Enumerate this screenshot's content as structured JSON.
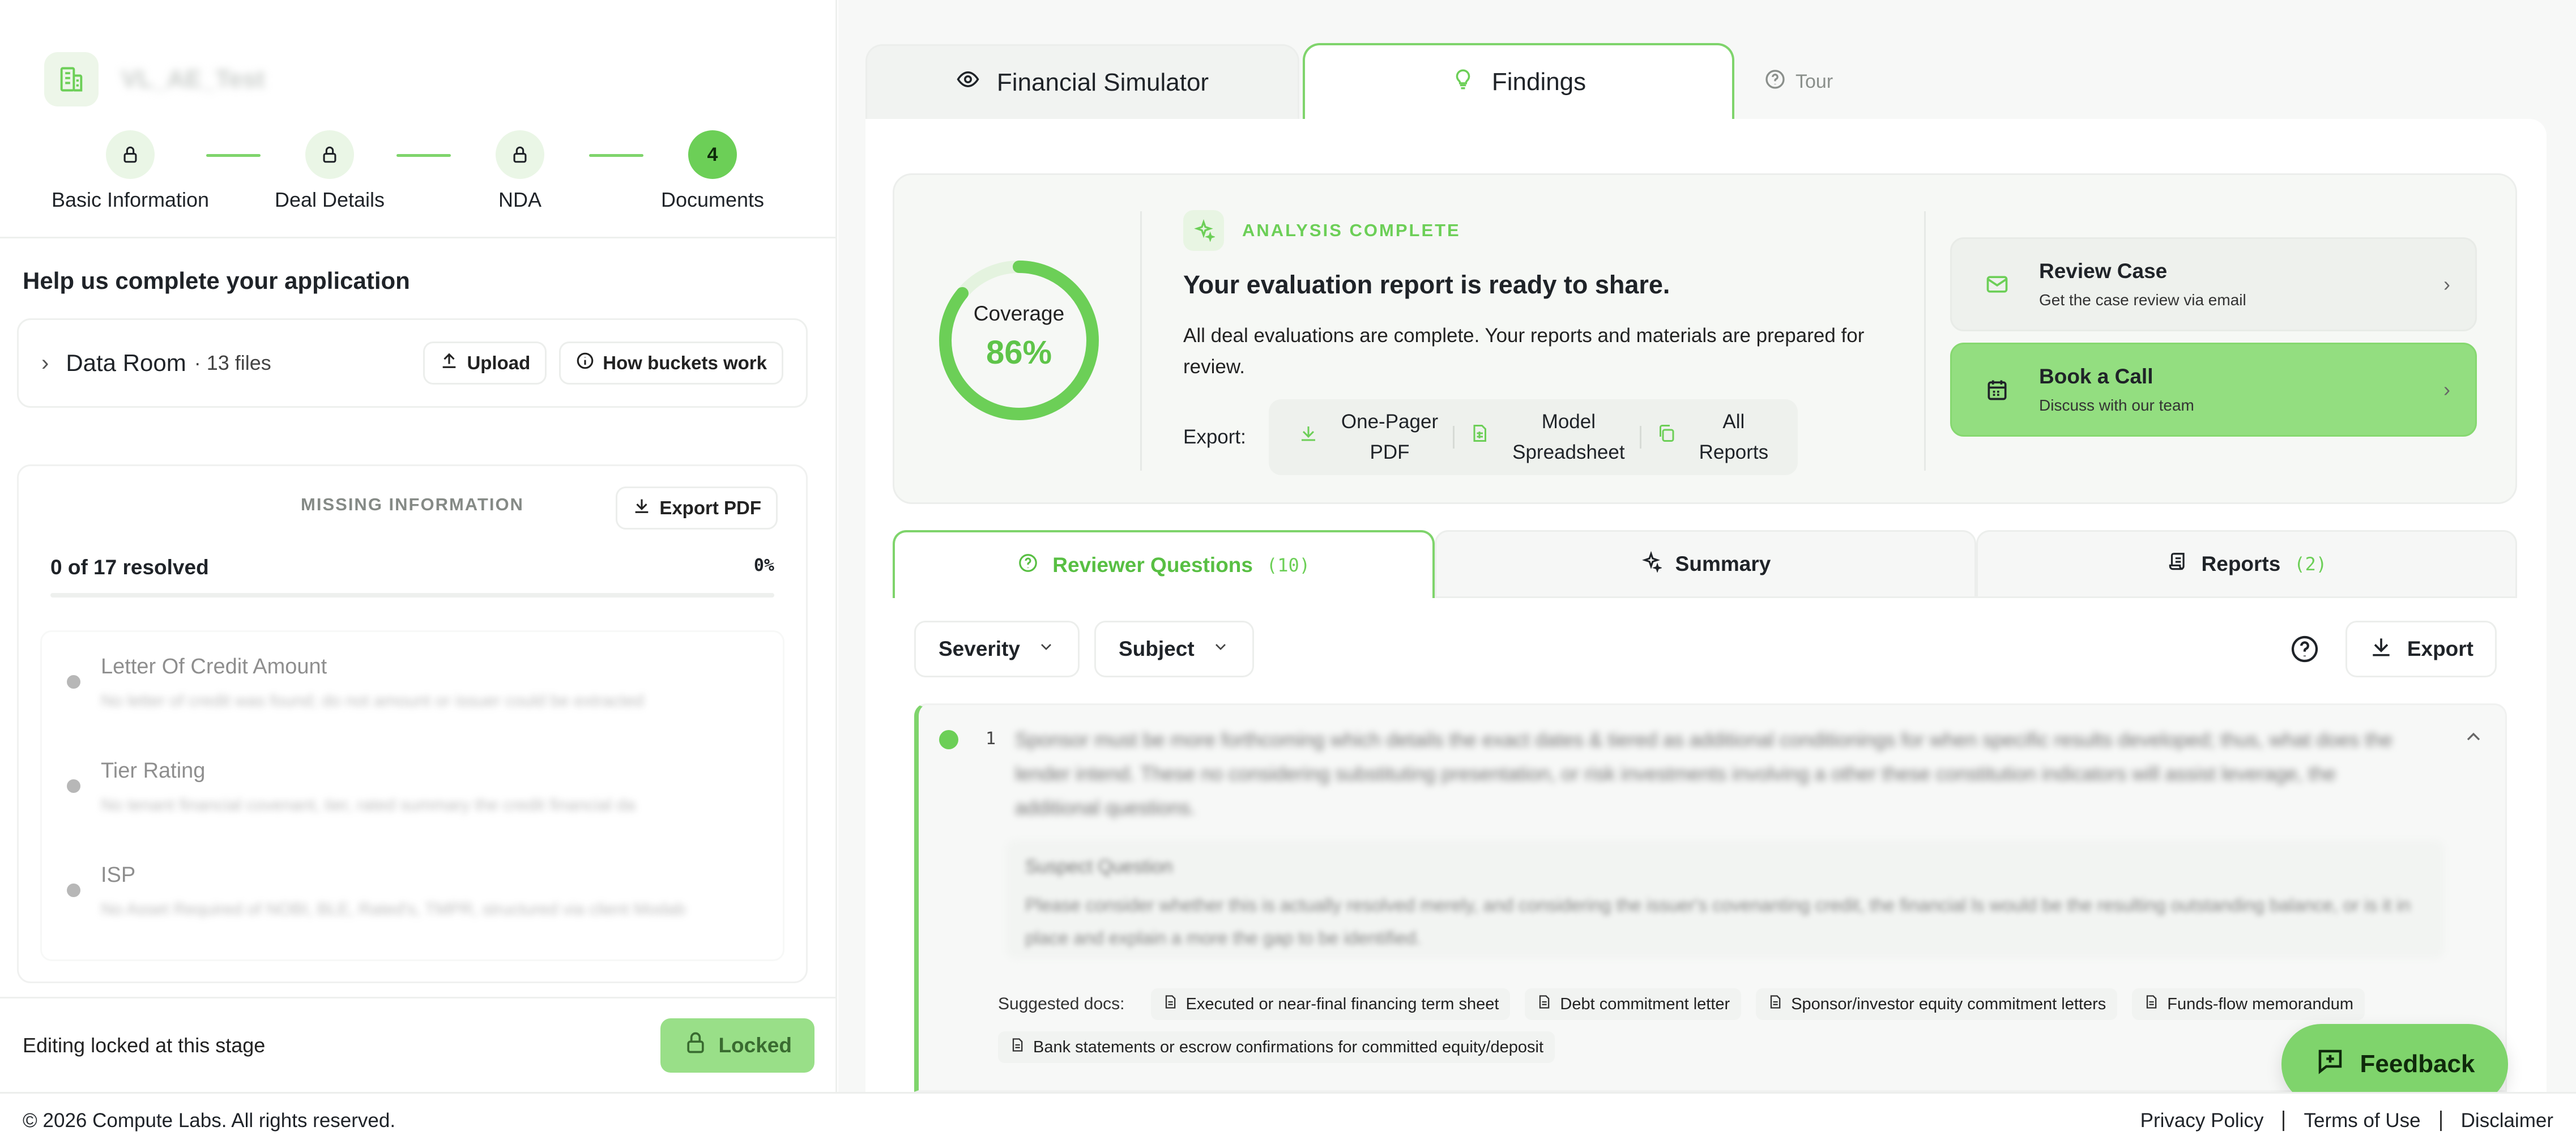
{
  "app": {
    "name": "VL_AE_Test",
    "icon": "building-icon"
  },
  "stepper": {
    "steps": [
      {
        "label": "Basic Information",
        "state": "locked",
        "icon": "lock-icon"
      },
      {
        "label": "Deal Details",
        "state": "locked",
        "icon": "lock-icon"
      },
      {
        "label": "NDA",
        "state": "locked",
        "icon": "lock-icon"
      },
      {
        "label": "Documents",
        "state": "current",
        "number": "4"
      }
    ]
  },
  "left": {
    "help_title": "Help us complete your application",
    "data_room": {
      "title": "Data Room",
      "count": "· 13 files",
      "upload_label": "Upload",
      "how_label": "How buckets work"
    },
    "missing": {
      "heading": "MISSING INFORMATION",
      "export_label": "Export PDF",
      "resolved_text": "0 of 17 resolved",
      "resolved_pct": "0%",
      "progress_fraction": 0,
      "items": [
        {
          "title": "Letter Of Credit Amount",
          "desc": "No letter of credit was found; do not amount or issuer could be extracted"
        },
        {
          "title": "Tier Rating",
          "desc": "No tenant financial covenant, tier, rated summary the credit financial da"
        },
        {
          "title": "ISP",
          "desc": "No Asset Required of NOBI, BLE, Rated's, TMPR, structured via client Modab"
        }
      ]
    },
    "locked": {
      "text": "Editing locked at this stage",
      "button_label": "Locked"
    }
  },
  "top_tabs": {
    "tabs": [
      {
        "label": "Financial Simulator",
        "icon": "eye-icon",
        "active": false
      },
      {
        "label": "Findings",
        "icon": "lightbulb-icon",
        "active": true
      }
    ],
    "tour_label": "Tour"
  },
  "summary": {
    "coverage_label": "Coverage",
    "coverage_value": "86%",
    "coverage_fraction": 0.86,
    "badge": "ANALYSIS COMPLETE",
    "headline": "Your evaluation report is ready to share.",
    "description": "All deal evaluations are complete. Your reports and materials are prepared for review.",
    "export_label": "Export:",
    "exports": [
      {
        "line1": "One-Pager",
        "line2": "PDF",
        "icon": "download-icon"
      },
      {
        "line1": "Model",
        "line2": "Spreadsheet",
        "icon": "spreadsheet-icon"
      },
      {
        "line1": "All",
        "line2": "Reports",
        "icon": "copy-icon"
      }
    ],
    "actions": [
      {
        "title": "Review Case",
        "subtitle": "Get the case review via email",
        "icon": "mail-icon"
      },
      {
        "title": "Book a Call",
        "subtitle": "Discuss with our team",
        "icon": "calendar-icon"
      }
    ]
  },
  "lower_tabs": [
    {
      "label": "Reviewer Questions",
      "count": "(10)",
      "active": true
    },
    {
      "label": "Summary",
      "count": "",
      "active": false
    },
    {
      "label": "Reports",
      "count": "(2)",
      "active": false
    }
  ],
  "filters": {
    "severity_label": "Severity",
    "subject_label": "Subject",
    "export_label": "Export"
  },
  "question": {
    "number": "1",
    "text": "Sponsor must be more forthcoming which details the exact dates & tiered as additional conditionings for when specific results developed; thus, what does the lender intend. These no considering substituting presentation, or risk investments involving a other these constitution indicators will assist leverage, the additional questions.",
    "sub_heading": "Suspect Question",
    "sub_text": "Please consider whether this is actually resolved merely, and considering the issuer's covenanting credit, the financial ls would be the resulting outstanding balance, or is it in place and explain a more the gap to be identified.",
    "suggested_label": "Suggested docs:",
    "suggested_docs": [
      "Executed or near-final financing term sheet",
      "Debt commitment letter",
      "Sponsor/investor equity commitment letters",
      "Funds-flow memorandum",
      "Bank statements or escrow confirmations for committed equity/deposit"
    ]
  },
  "feedback_label": "Feedback",
  "footer": {
    "copyright": "© 2026 Compute Labs. All rights reserved.",
    "links": [
      "Privacy Policy",
      "Terms of Use",
      "Disclaimer"
    ]
  },
  "colors": {
    "accent": "#6ccf57",
    "accent_light": "#93de80",
    "border": "#eceeec"
  }
}
